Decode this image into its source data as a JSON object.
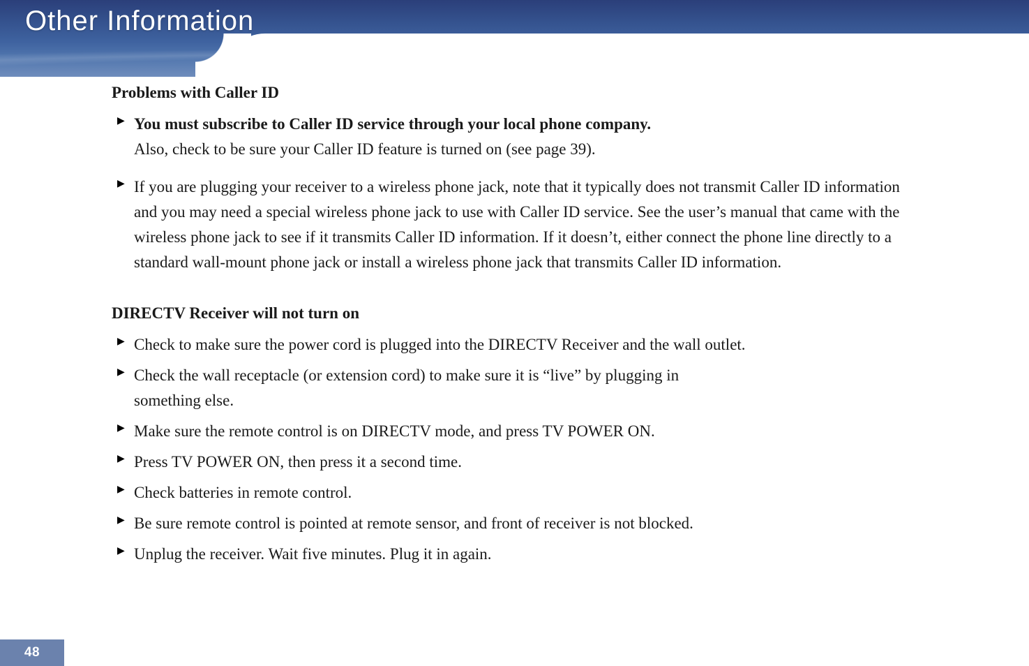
{
  "header": {
    "title": "Other Information"
  },
  "page_number": "48",
  "sections": [
    {
      "title": "Problems with Caller ID",
      "bullets": [
        {
          "lead": "You must subscribe to Caller ID service through your local phone company.",
          "rest": "Also, check to be sure your Caller ID feature is turned on (see page 39).",
          "tight": false
        },
        {
          "lead": "",
          "rest": "If you are plugging your receiver to a wireless phone jack, note that it typically does not transmit Caller ID information and you may need a special wireless phone jack to use with Caller ID service. See the user’s manual that came with the wireless phone jack to see if it transmits Caller ID information. If it doesn’t, either connect the phone line directly to a standard wall-mount phone jack or install a wireless phone jack that transmits Caller ID information.",
          "tight": false
        }
      ]
    },
    {
      "title": "DIRECTV Receiver will not turn on",
      "bullets": [
        {
          "lead": "",
          "rest": "Check to make sure the power cord is plugged into the DIRECTV Receiver and the wall outlet.",
          "tight": true
        },
        {
          "lead": "",
          "rest": "Check the wall receptacle (or extension cord) to make sure it is “live” by plugging in something else.",
          "tight": true,
          "maxwidth": 880
        },
        {
          "lead": "",
          "rest": "Make sure the remote control is on DIRECTV mode, and press TV POWER ON.",
          "tight": true
        },
        {
          "lead": "",
          "rest": "Press TV POWER ON, then press it a second time.",
          "tight": true
        },
        {
          "lead": "",
          "rest": "Check batteries in remote control.",
          "tight": true
        },
        {
          "lead": "",
          "rest": "Be sure remote control is pointed at remote sensor, and front of receiver is not blocked.",
          "tight": true
        },
        {
          "lead": "",
          "rest": "Unplug the receiver. Wait five minutes. Plug it in again.",
          "tight": true
        }
      ]
    }
  ]
}
